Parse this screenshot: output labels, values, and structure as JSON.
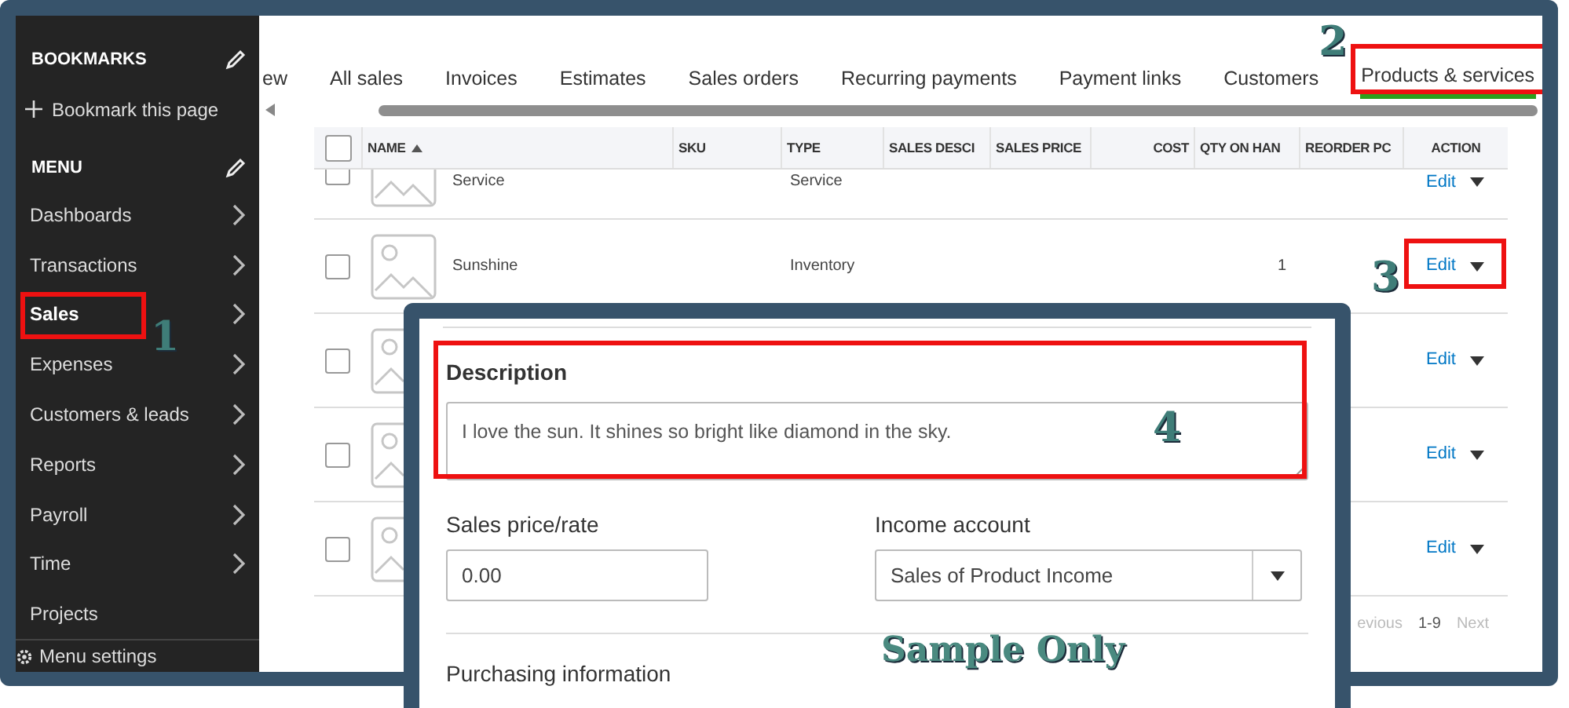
{
  "sidebar": {
    "bookmarks_title": "BOOKMARKS",
    "bookmark_action": "Bookmark this page",
    "menu_title": "MENU",
    "items": [
      {
        "label": "Dashboards",
        "has_submenu": true
      },
      {
        "label": "Transactions",
        "has_submenu": true
      },
      {
        "label": "Sales",
        "has_submenu": true,
        "annotation": "1"
      },
      {
        "label": "Expenses",
        "has_submenu": true
      },
      {
        "label": "Customers & leads",
        "has_submenu": true
      },
      {
        "label": "Reports",
        "has_submenu": true
      },
      {
        "label": "Payroll",
        "has_submenu": true
      },
      {
        "label": "Time",
        "has_submenu": true
      },
      {
        "label": "Projects",
        "has_submenu": false
      }
    ],
    "footer": "Menu settings"
  },
  "tabs": [
    {
      "label": "ew",
      "selected": false
    },
    {
      "label": "All sales",
      "selected": false
    },
    {
      "label": "Invoices",
      "selected": false
    },
    {
      "label": "Estimates",
      "selected": false
    },
    {
      "label": "Sales orders",
      "selected": false
    },
    {
      "label": "Recurring payments",
      "selected": false
    },
    {
      "label": "Payment links",
      "selected": false
    },
    {
      "label": "Customers",
      "selected": false
    },
    {
      "label": "Products & services",
      "selected": true,
      "annotation": "2"
    }
  ],
  "table": {
    "select_all_checked": false,
    "columns": [
      "NAME",
      "SKU",
      "TYPE",
      "SALES DESCI",
      "SALES PRICE",
      "COST",
      "QTY ON HAN",
      "REORDER PC",
      "ACTION"
    ],
    "rows": [
      {
        "name": "Service",
        "type": "Service",
        "action": "Edit",
        "cut": true,
        "checked": false
      },
      {
        "name": "Sunshine",
        "type": "Inventory",
        "qty": "1",
        "action": "Edit",
        "cut": false,
        "checked": false,
        "annotation": "3"
      },
      {
        "action": "Edit",
        "cut": false,
        "checked": false
      },
      {
        "action": "Edit",
        "cut": false,
        "checked": false
      },
      {
        "action": "Edit",
        "cut": false,
        "checked": false
      }
    ],
    "pagination": {
      "previous": "evious",
      "range": "1-9",
      "next": "Next"
    }
  },
  "dialog": {
    "description_label": "Description",
    "description_value": "I love the sun. It shines so bright like diamond in the sky.",
    "description_annotation": "4",
    "price_label": "Sales price/rate",
    "price_value": "0.00",
    "income_label": "Income account",
    "income_value": "Sales of Product Income",
    "purchasing_label": "Purchasing information"
  },
  "stamp": "Sample Only"
}
